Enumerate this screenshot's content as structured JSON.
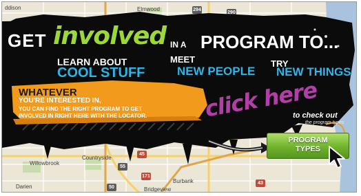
{
  "banner": {
    "headline_get": "GET",
    "headline_involved": "involved",
    "headline_in_a": "IN A",
    "headline_program_to": "PROGRAM TO...",
    "learn_about": "LEARN ABOUT",
    "cool_stuff": "COOL STUFF",
    "meet": "MEET",
    "new_people": "NEW PEOPLE",
    "try": "TRY",
    "new_things": "NEW THINGS",
    "whatever": "WHATEVER",
    "youre_interested": "YOU'RE INTERESTED IN,",
    "can_find_line1": "YOU CAN FIND THE RIGHT PROGRAM TO GET",
    "can_find_line2": "INVOLVED IN RIGHT HERE WITH THE LOCATOR.",
    "click_here": "click here",
    "to_check_out": "to check out",
    "the_program_types": "the program types"
  },
  "button": {
    "line1": "PROGRAM",
    "line2": "TYPES"
  },
  "map": {
    "labels": {
      "addison": "ddison",
      "elmwood": "Elmwood",
      "willowbrook": "Willowbrook",
      "countryside": "Countryside",
      "darien": "Darien",
      "burbank": "Burbank",
      "bridgeview": "Bridgeview"
    },
    "shields": {
      "i294": "294",
      "i290": "290",
      "i45": "45",
      "i55": "55",
      "i171": "171",
      "i50": "50",
      "i43": "43"
    }
  },
  "colors": {
    "accent_green": "#9dd83a",
    "accent_blue": "#2fb6e8",
    "accent_orange": "#f19a1c",
    "accent_purple": "#b23fa8",
    "banner_black": "#0b0b0b",
    "map_background": "#efe9dc"
  },
  "icons": {
    "cursor": "cursor-arrow-icon",
    "arrow": "curved-arrow-icon"
  }
}
